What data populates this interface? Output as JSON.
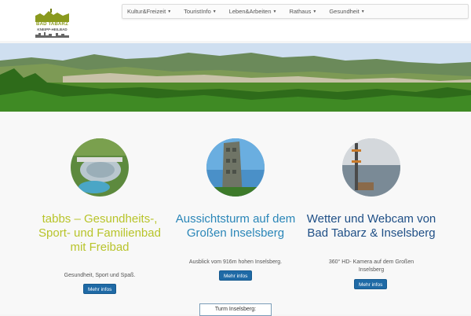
{
  "logo": {
    "line1": "BAD TABARZ",
    "line2": "KNEIPP-HEILBAD"
  },
  "nav": {
    "items": [
      {
        "label": "Kultur&Freizeit"
      },
      {
        "label": "TouristInfo"
      },
      {
        "label": "Leben&Arbeiten"
      },
      {
        "label": "Rathaus"
      },
      {
        "label": "Gesundheit"
      }
    ]
  },
  "features": [
    {
      "title": "tabbs – Gesundheits-, Sport- und Familienbad mit Freibad",
      "text": "Gesundheit, Sport und Spaß.",
      "button": "Mehr infos",
      "color": "#b8c42a"
    },
    {
      "title": "Aussichtsturm auf dem Großen Inselsberg",
      "text": "Ausblick vom 916m hohen Inselsberg.",
      "button": "Mehr infos",
      "color": "#2a86b8"
    },
    {
      "title": "Wetter und Webcam von Bad Tabarz & Inselsberg",
      "text": "360° HD- Kamera auf dem Großen Inselsberg",
      "button": "Mehr infos",
      "color": "#1f4f86"
    }
  ],
  "turm_box": {
    "label": "Turm Inselsberg:"
  }
}
